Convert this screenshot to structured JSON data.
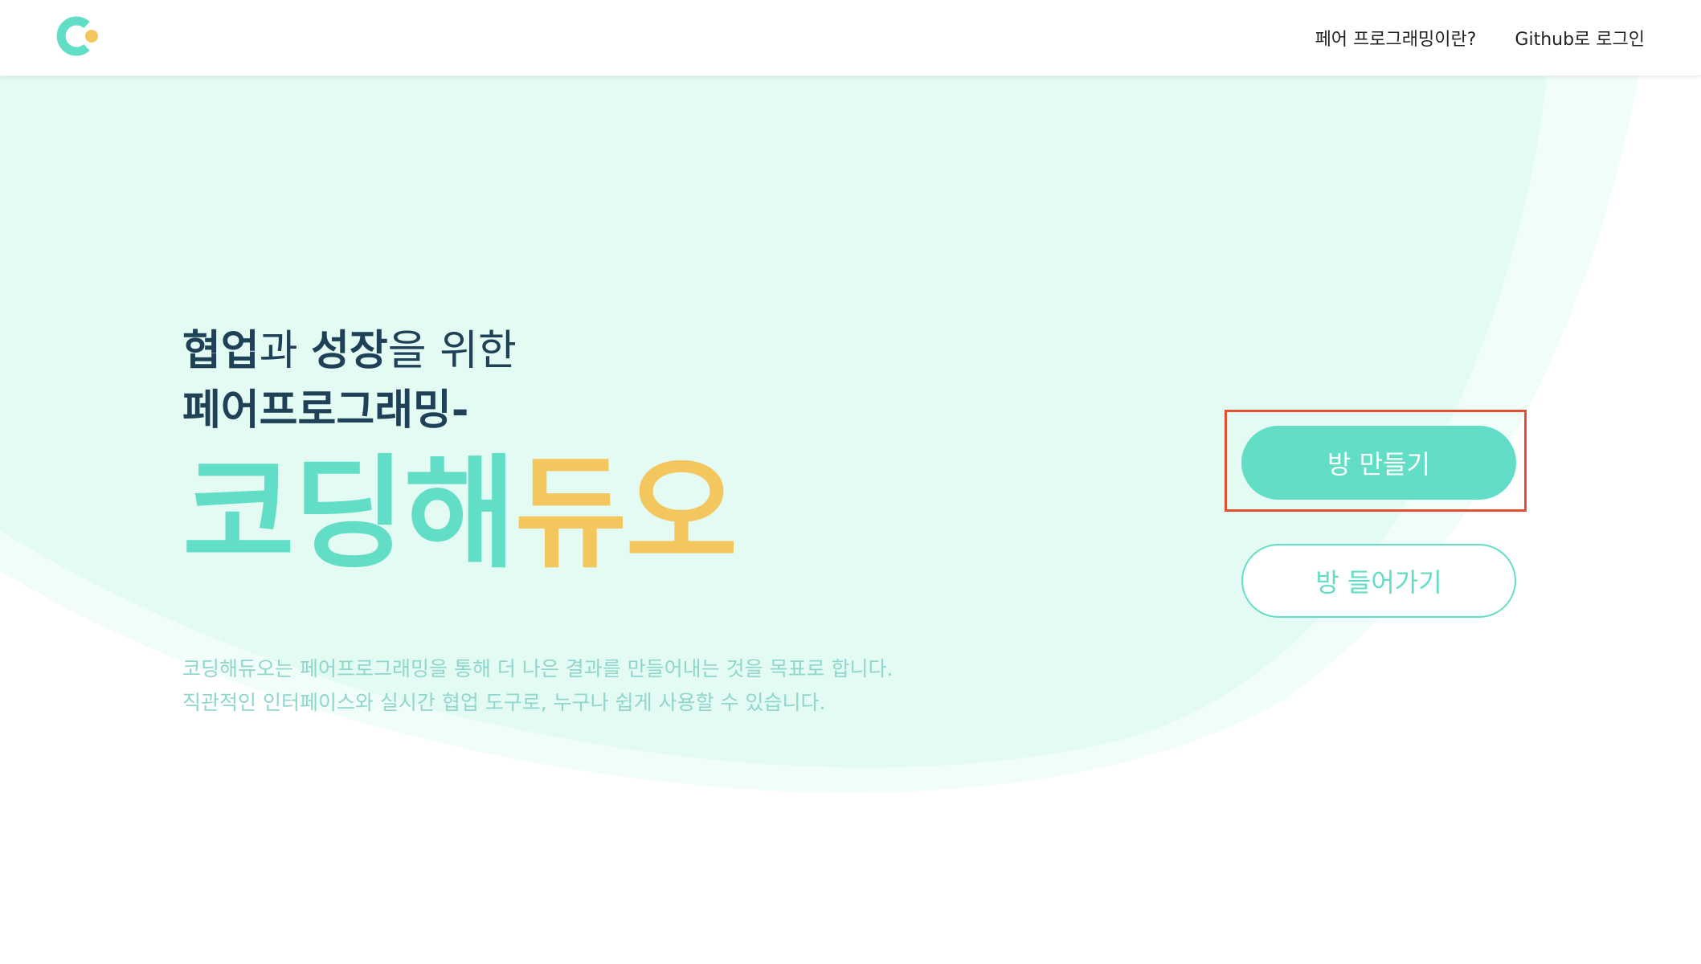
{
  "nav": {
    "logo_icon": "coding-duo-logo-icon",
    "links": [
      {
        "label": "페어 프로그래밍이란?"
      },
      {
        "label": "Github로 로그인"
      }
    ]
  },
  "hero": {
    "tagline_line1": {
      "part1": "협업",
      "part2": "과 ",
      "part3": "성장",
      "part4": "을 위한"
    },
    "tagline_line2": "페어프로그래밍-",
    "brand": {
      "part_mint": "코딩해",
      "part_yellow": "듀오"
    },
    "description": [
      "코딩해듀오는 페어프로그래밍을 통해 더 나은 결과를 만들어내는 것을 목표로 합니다.",
      "직관적인 인터페이스와 실시간 협업 도구로, 누구나 쉽게 사용할 수 있습니다."
    ]
  },
  "actions": {
    "create_room": "방 만들기",
    "join_room": "방 들어가기"
  },
  "colors": {
    "mint": "#63dec6",
    "yellow": "#f4c65e",
    "navy": "#1e4158",
    "mint_bg": "#e3fbf3",
    "highlight": "#e4502f"
  }
}
